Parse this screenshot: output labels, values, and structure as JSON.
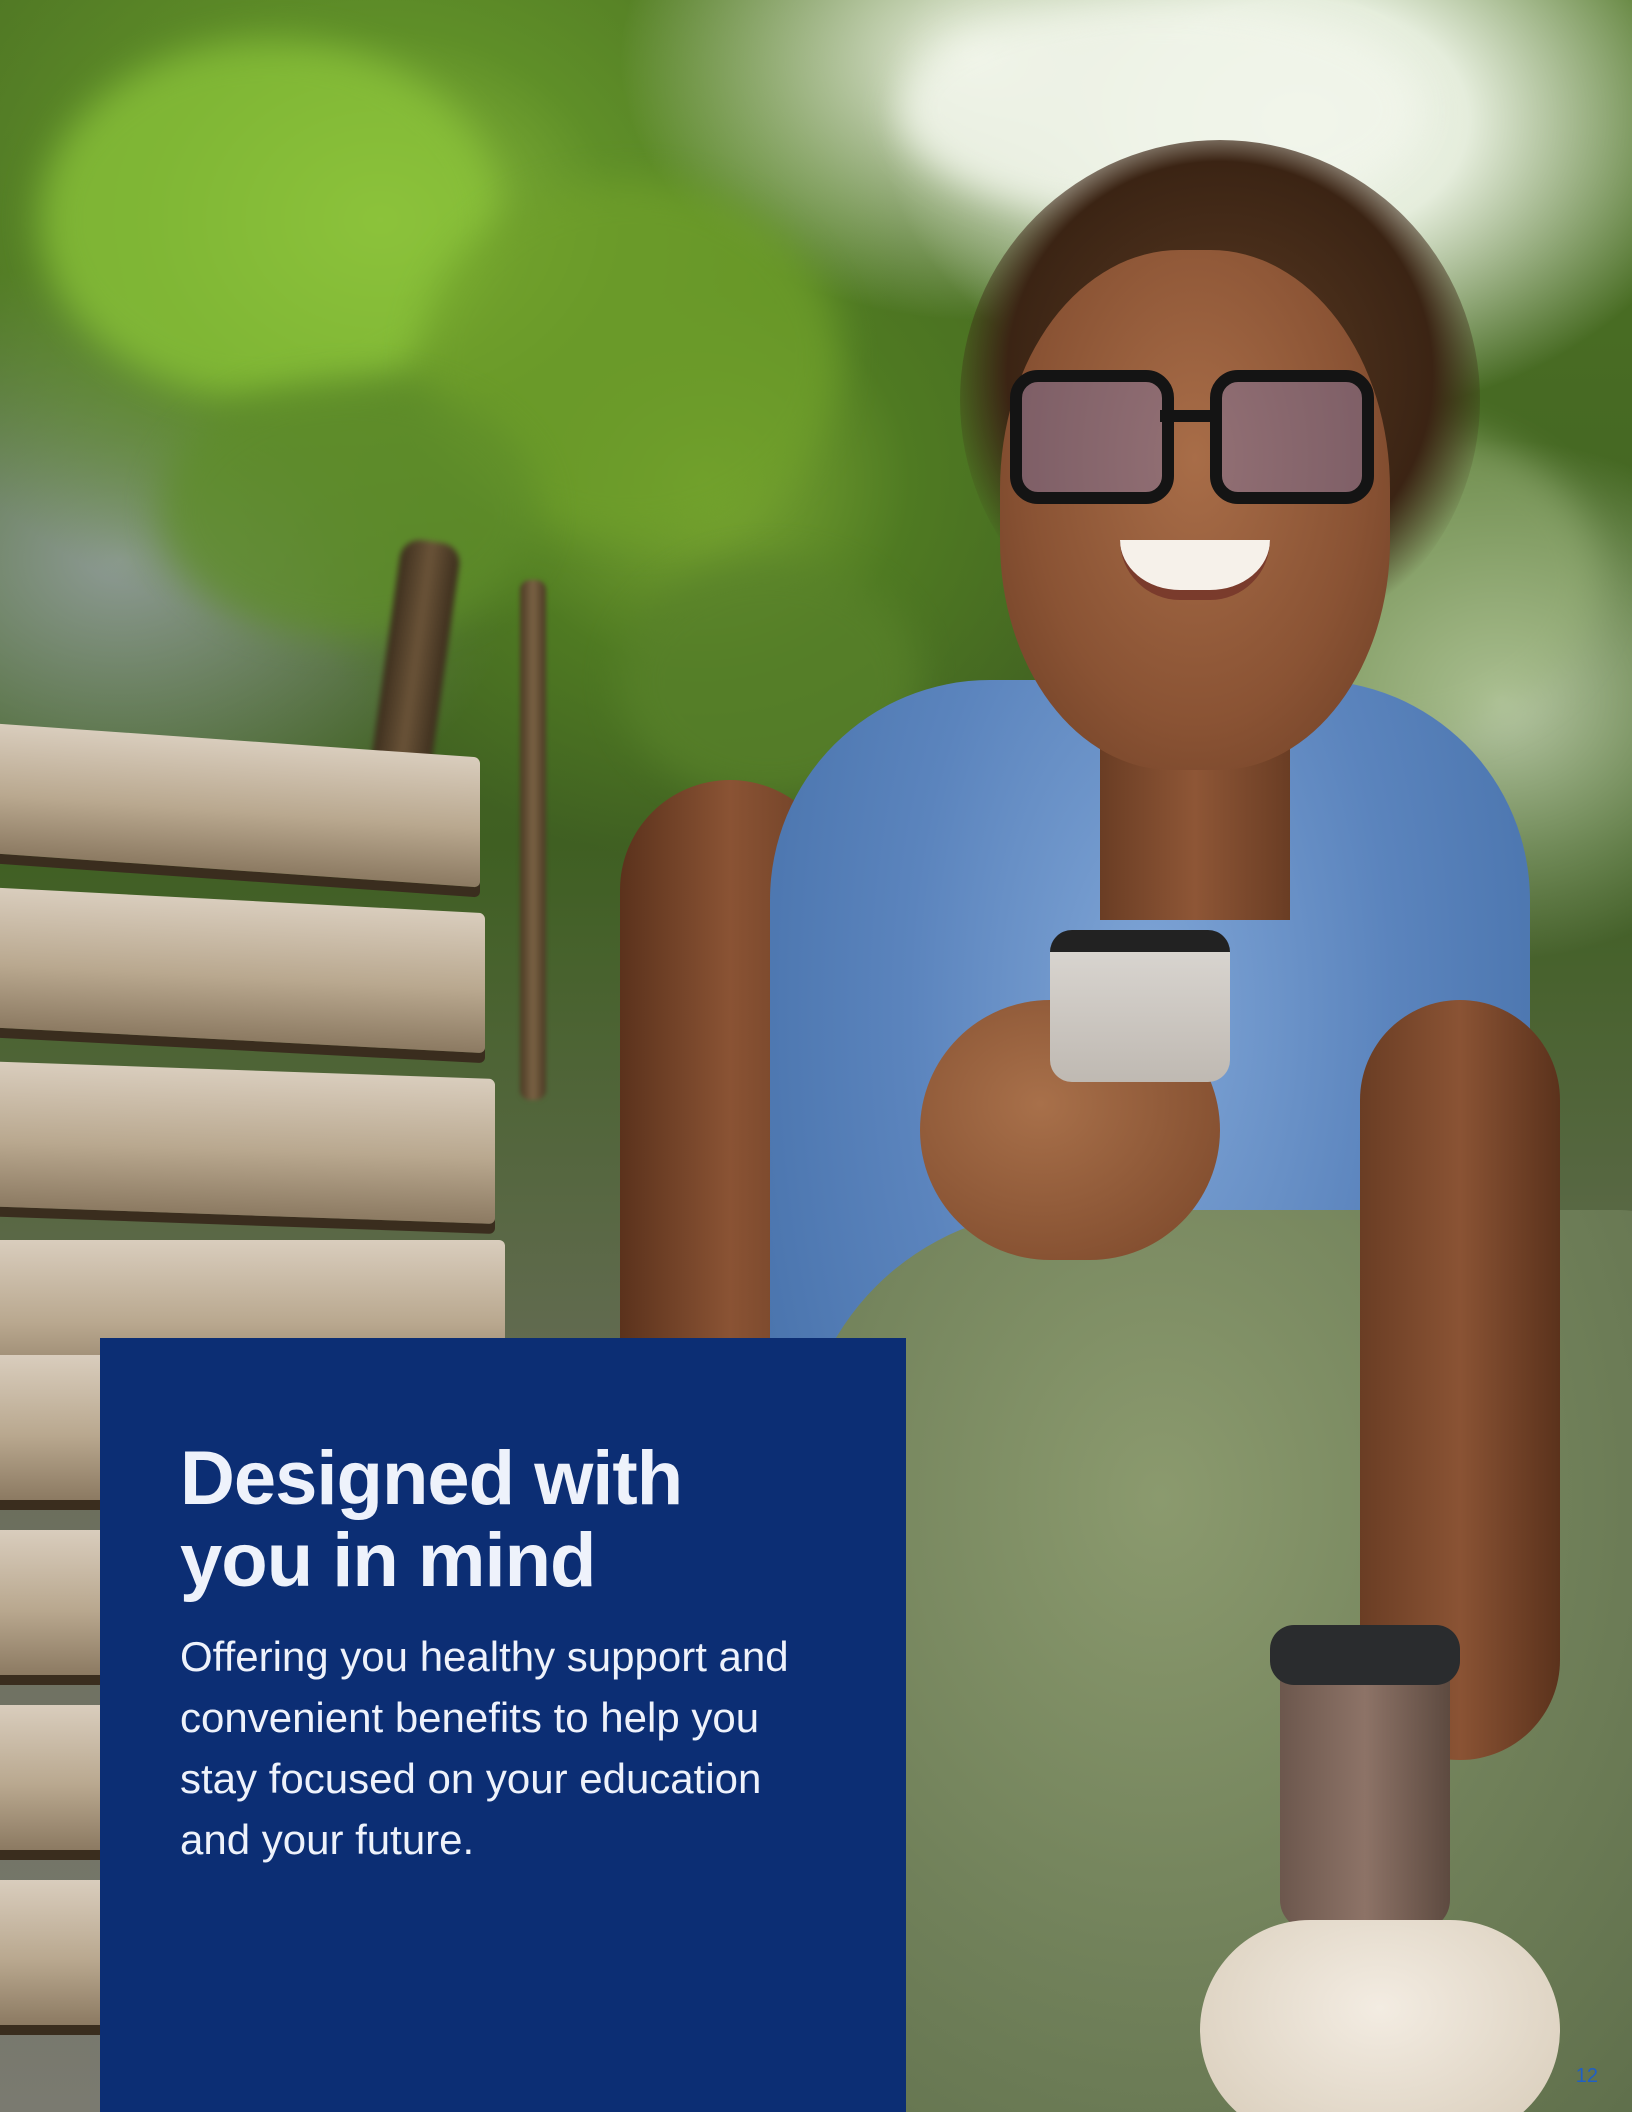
{
  "panel": {
    "headline": "Designed with\nyou in mind",
    "body": "Offering you healthy support and convenient benefits to help you stay focused on your education and your future."
  },
  "page_number": "12",
  "colors": {
    "panel_background": "#0c2e74",
    "panel_text": "#eef2fb",
    "page_number": "#1f5fc4"
  }
}
